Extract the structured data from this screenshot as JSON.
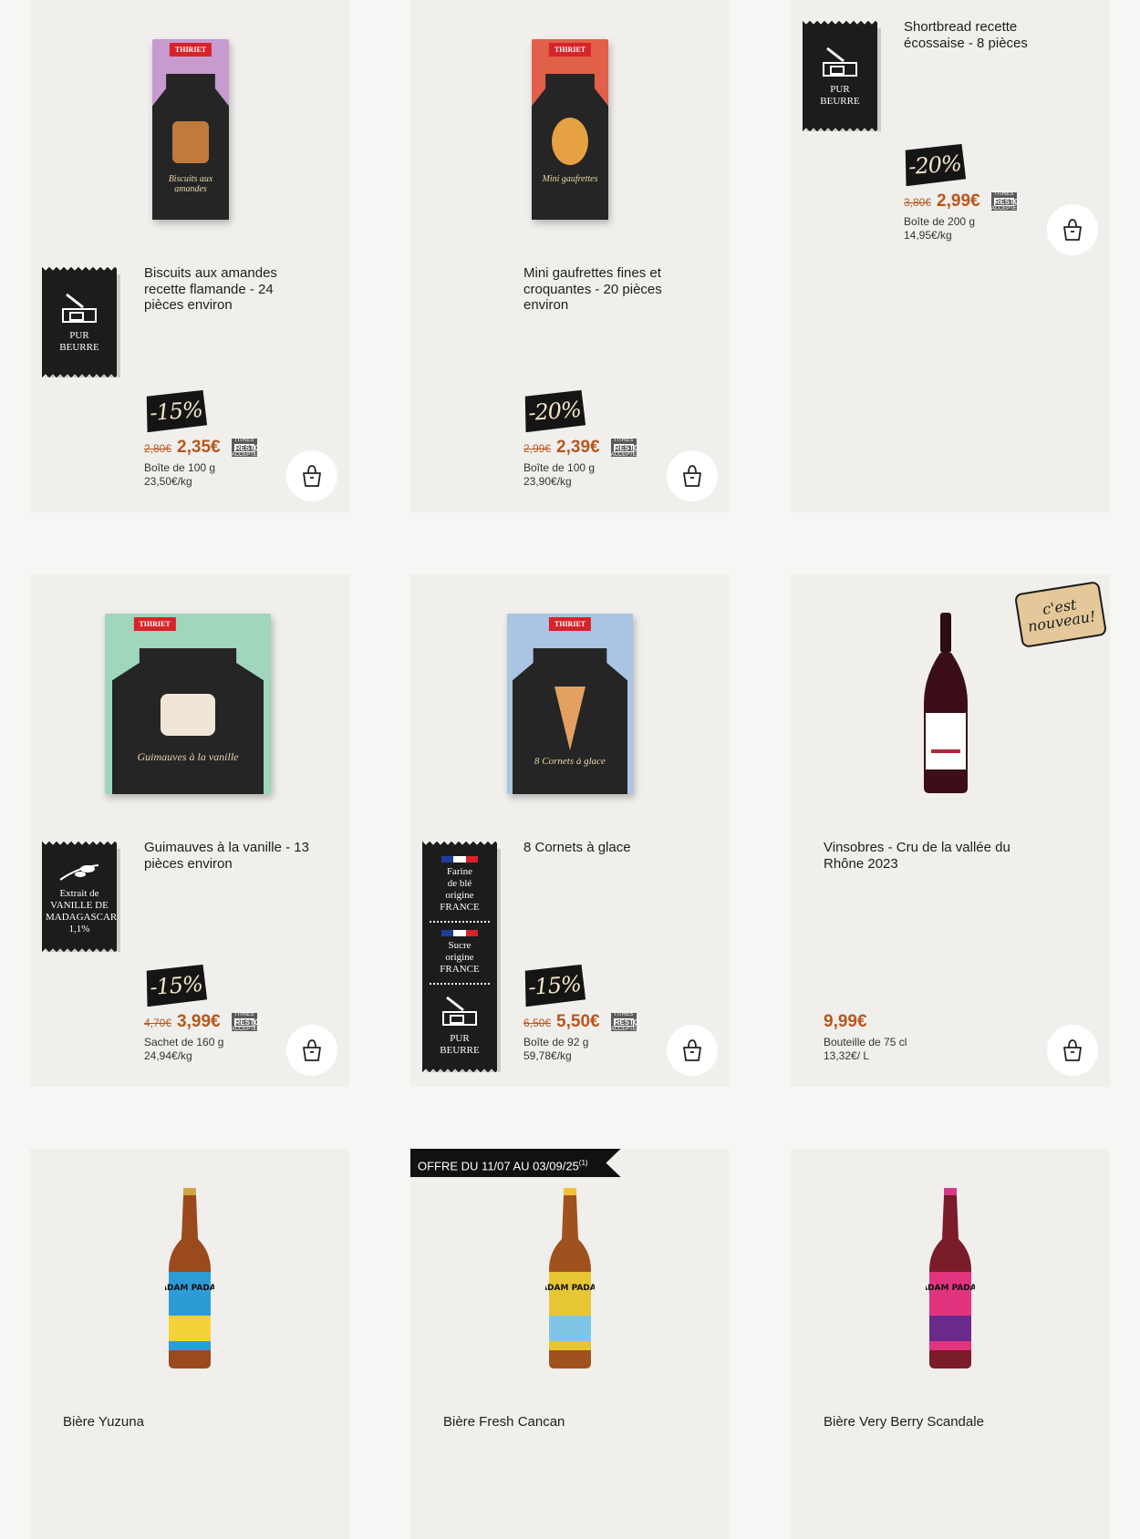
{
  "colors": {
    "page_bg": "#f7f6f4",
    "card_bg": "#f1efec",
    "price": "#b8561d",
    "badge_dark": "#151515"
  },
  "labels": {
    "pur_beurre_l1": "PUR",
    "pur_beurre_l2": "BEURRE",
    "resto_top": "TITRES",
    "resto_mid": "RESTO",
    "resto_bot": "ACCEPTÉS",
    "vanille": [
      "Extrait de",
      "VANILLE DE",
      "MADAGASCAR",
      "1,1%"
    ],
    "farine": [
      "Farine",
      "de blé",
      "origine",
      "FRANCE"
    ],
    "sucre": [
      "Sucre",
      "origine",
      "FRANCE"
    ],
    "nouveau_l1": "c'est",
    "nouveau_l2": "nouveau!",
    "brand": "THIRIET",
    "offer": "OFFRE DU 11/07 AU 03/09/25",
    "offer_note": "(1)"
  },
  "products": [
    {
      "title": "Biscuits aux amandes recette flamande - 24 pièces environ",
      "discount": "-15%",
      "old_price": "2,80€",
      "price": "2,35€",
      "pack": "Boîte de 100 g",
      "unit": "23,50€/kg",
      "pack_label": "Biscuits aux amandes"
    },
    {
      "title": "Mini gaufrettes fines et croquantes - 20 pièces environ",
      "discount": "-20%",
      "old_price": "2,99€",
      "price": "2,39€",
      "pack": "Boîte de 100 g",
      "unit": "23,90€/kg",
      "pack_label": "Mini gaufrettes"
    },
    {
      "title": "Shortbread recette écossaise - 8 pièces",
      "discount": "-20%",
      "old_price": "3,80€",
      "price": "2,99€",
      "pack": "Boîte de 200 g",
      "unit": "14,95€/kg"
    },
    {
      "title": "Guimauves à la vanille - 13 pièces environ",
      "discount": "-15%",
      "old_price": "4,70€",
      "price": "3,99€",
      "pack": "Sachet de 160 g",
      "unit": "24,94€/kg",
      "pack_label": "Guimauves à la vanille"
    },
    {
      "title": "8 Cornets à glace",
      "discount": "-15%",
      "old_price": "6,50€",
      "price": "5,50€",
      "pack": "Boîte de 92 g",
      "unit": "59,78€/kg",
      "pack_label": "8 Cornets à glace"
    },
    {
      "title": "Vinsobres - Cru de la vallée du Rhône 2023",
      "price": "9,99€",
      "pack": "Bouteille de 75 cl",
      "unit": "13,32€/ L"
    },
    {
      "title": "Bière Yuzuna",
      "beer_label": "PADAM PADAM"
    },
    {
      "title": "Bière Fresh Cancan",
      "beer_label": "PADAM PADAM"
    },
    {
      "title": "Bière Very Berry Scandale",
      "beer_label": "PADAM PADAM"
    }
  ]
}
